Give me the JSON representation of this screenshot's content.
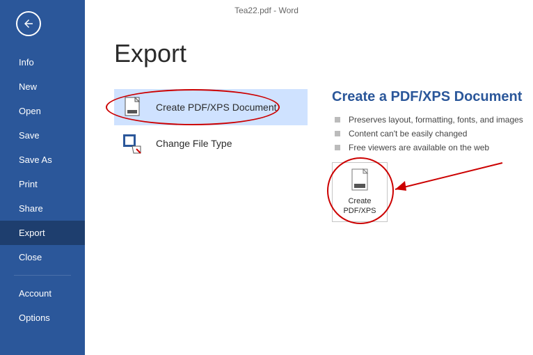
{
  "titlebar": {
    "text": "Tea22.pdf - Word"
  },
  "sidebar": {
    "items": [
      {
        "label": "Info"
      },
      {
        "label": "New"
      },
      {
        "label": "Open"
      },
      {
        "label": "Save"
      },
      {
        "label": "Save As"
      },
      {
        "label": "Print"
      },
      {
        "label": "Share"
      },
      {
        "label": "Export"
      },
      {
        "label": "Close"
      }
    ],
    "footer": [
      {
        "label": "Account"
      },
      {
        "label": "Options"
      }
    ]
  },
  "main": {
    "title": "Export",
    "options": [
      {
        "label": "Create PDF/XPS Document"
      },
      {
        "label": "Change File Type"
      }
    ],
    "details": {
      "title": "Create a PDF/XPS Document",
      "bullets": [
        "Preserves layout, formatting, fonts, and images",
        "Content can't be easily changed",
        "Free viewers are available on the web"
      ],
      "button_label": "Create\nPDF/XPS"
    }
  }
}
